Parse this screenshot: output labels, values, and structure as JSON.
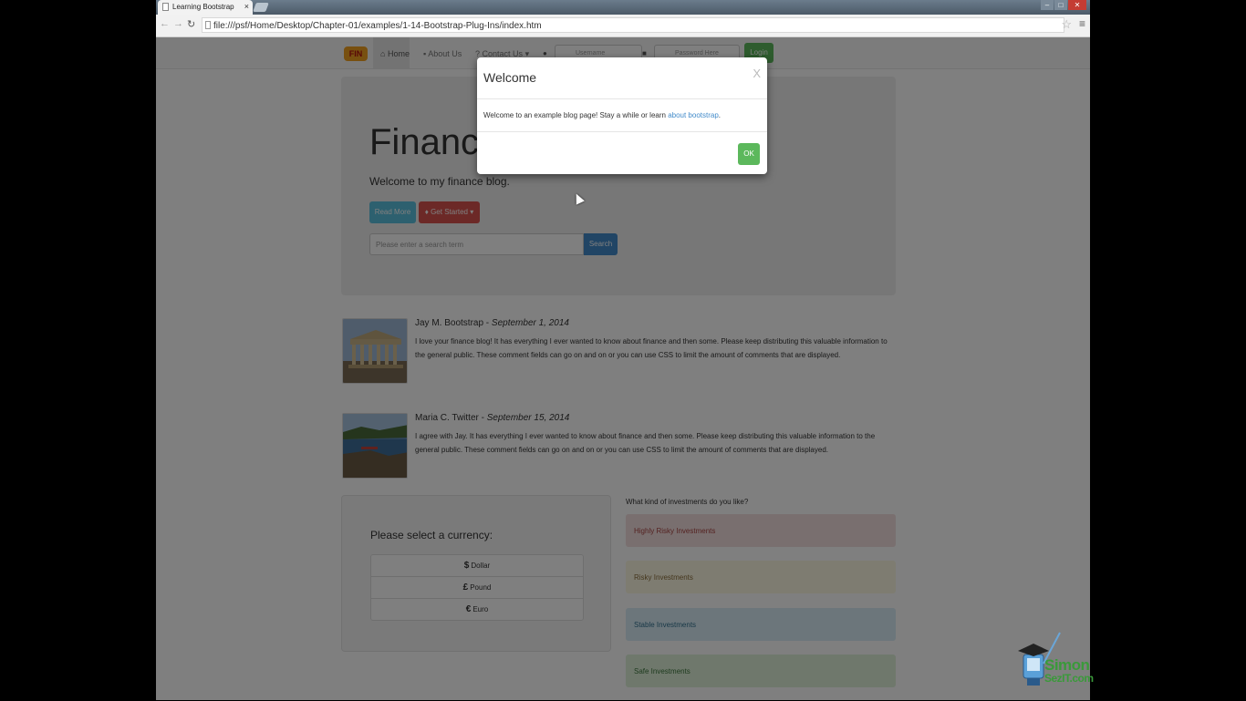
{
  "browser": {
    "tab_title": "Learning Bootstrap",
    "tab_close": "×",
    "url": "file:///psf/Home/Desktop/Chapter-01/examples/1-14-Bootstrap-Plug-Ins/index.htm",
    "window_controls": [
      "–",
      "□",
      "✕"
    ]
  },
  "navbar": {
    "brand": "FIN",
    "home": "Home",
    "about": "About Us",
    "contact": "Contact Us",
    "username_placeholder": "Username",
    "password_placeholder": "Password Here",
    "login": "Login"
  },
  "jumbotron": {
    "title": "Finance",
    "subtitle": "Welcome to my finance blog.",
    "read_more": "Read More",
    "get_started": "Get Started",
    "search_placeholder": "Please enter a search term",
    "search_button": "Search"
  },
  "comments": [
    {
      "author": "Jay M. Bootstrap - ",
      "date": "September 1, 2014",
      "text": "I love your finance blog! It has everything I ever wanted to know about finance and then some. Please keep distributing this valuable information to the general public. These comment fields can go on and on or you can use CSS to limit the amount of comments that are displayed."
    },
    {
      "author": "Maria C. Twitter - ",
      "date": "September 15, 2014",
      "text": "I agree with Jay. It has everything I ever wanted to know about finance and then some. Please keep distributing this valuable information to the general public. These comment fields can go on and on or you can use CSS to limit the amount of comments that are displayed."
    }
  ],
  "currency": {
    "title": "Please select a currency:",
    "options": [
      {
        "symbol": "$",
        "label": "Dollar"
      },
      {
        "symbol": "£",
        "label": "Pound"
      },
      {
        "symbol": "€",
        "label": "Euro"
      }
    ]
  },
  "investments": {
    "question": "What kind of investments do you like?",
    "options": [
      {
        "label": "Highly Risky Investments",
        "bg": "#f2dede",
        "color": "#a94442"
      },
      {
        "label": "Risky Investments",
        "bg": "#fcf8e3",
        "color": "#8a6d3b"
      },
      {
        "label": "Stable Investments",
        "bg": "#d9edf7",
        "color": "#31708f"
      },
      {
        "label": "Safe Investments",
        "bg": "#dff0d8",
        "color": "#3c763d"
      }
    ]
  },
  "modal": {
    "title": "Welcome",
    "close": "X",
    "body_text": "Welcome to an example blog page! Stay a while or learn ",
    "body_link": "about bootstrap",
    "body_end": ".",
    "ok": "OK"
  },
  "watermark": {
    "line1": "Simon",
    "line2": "SezIT.com"
  }
}
